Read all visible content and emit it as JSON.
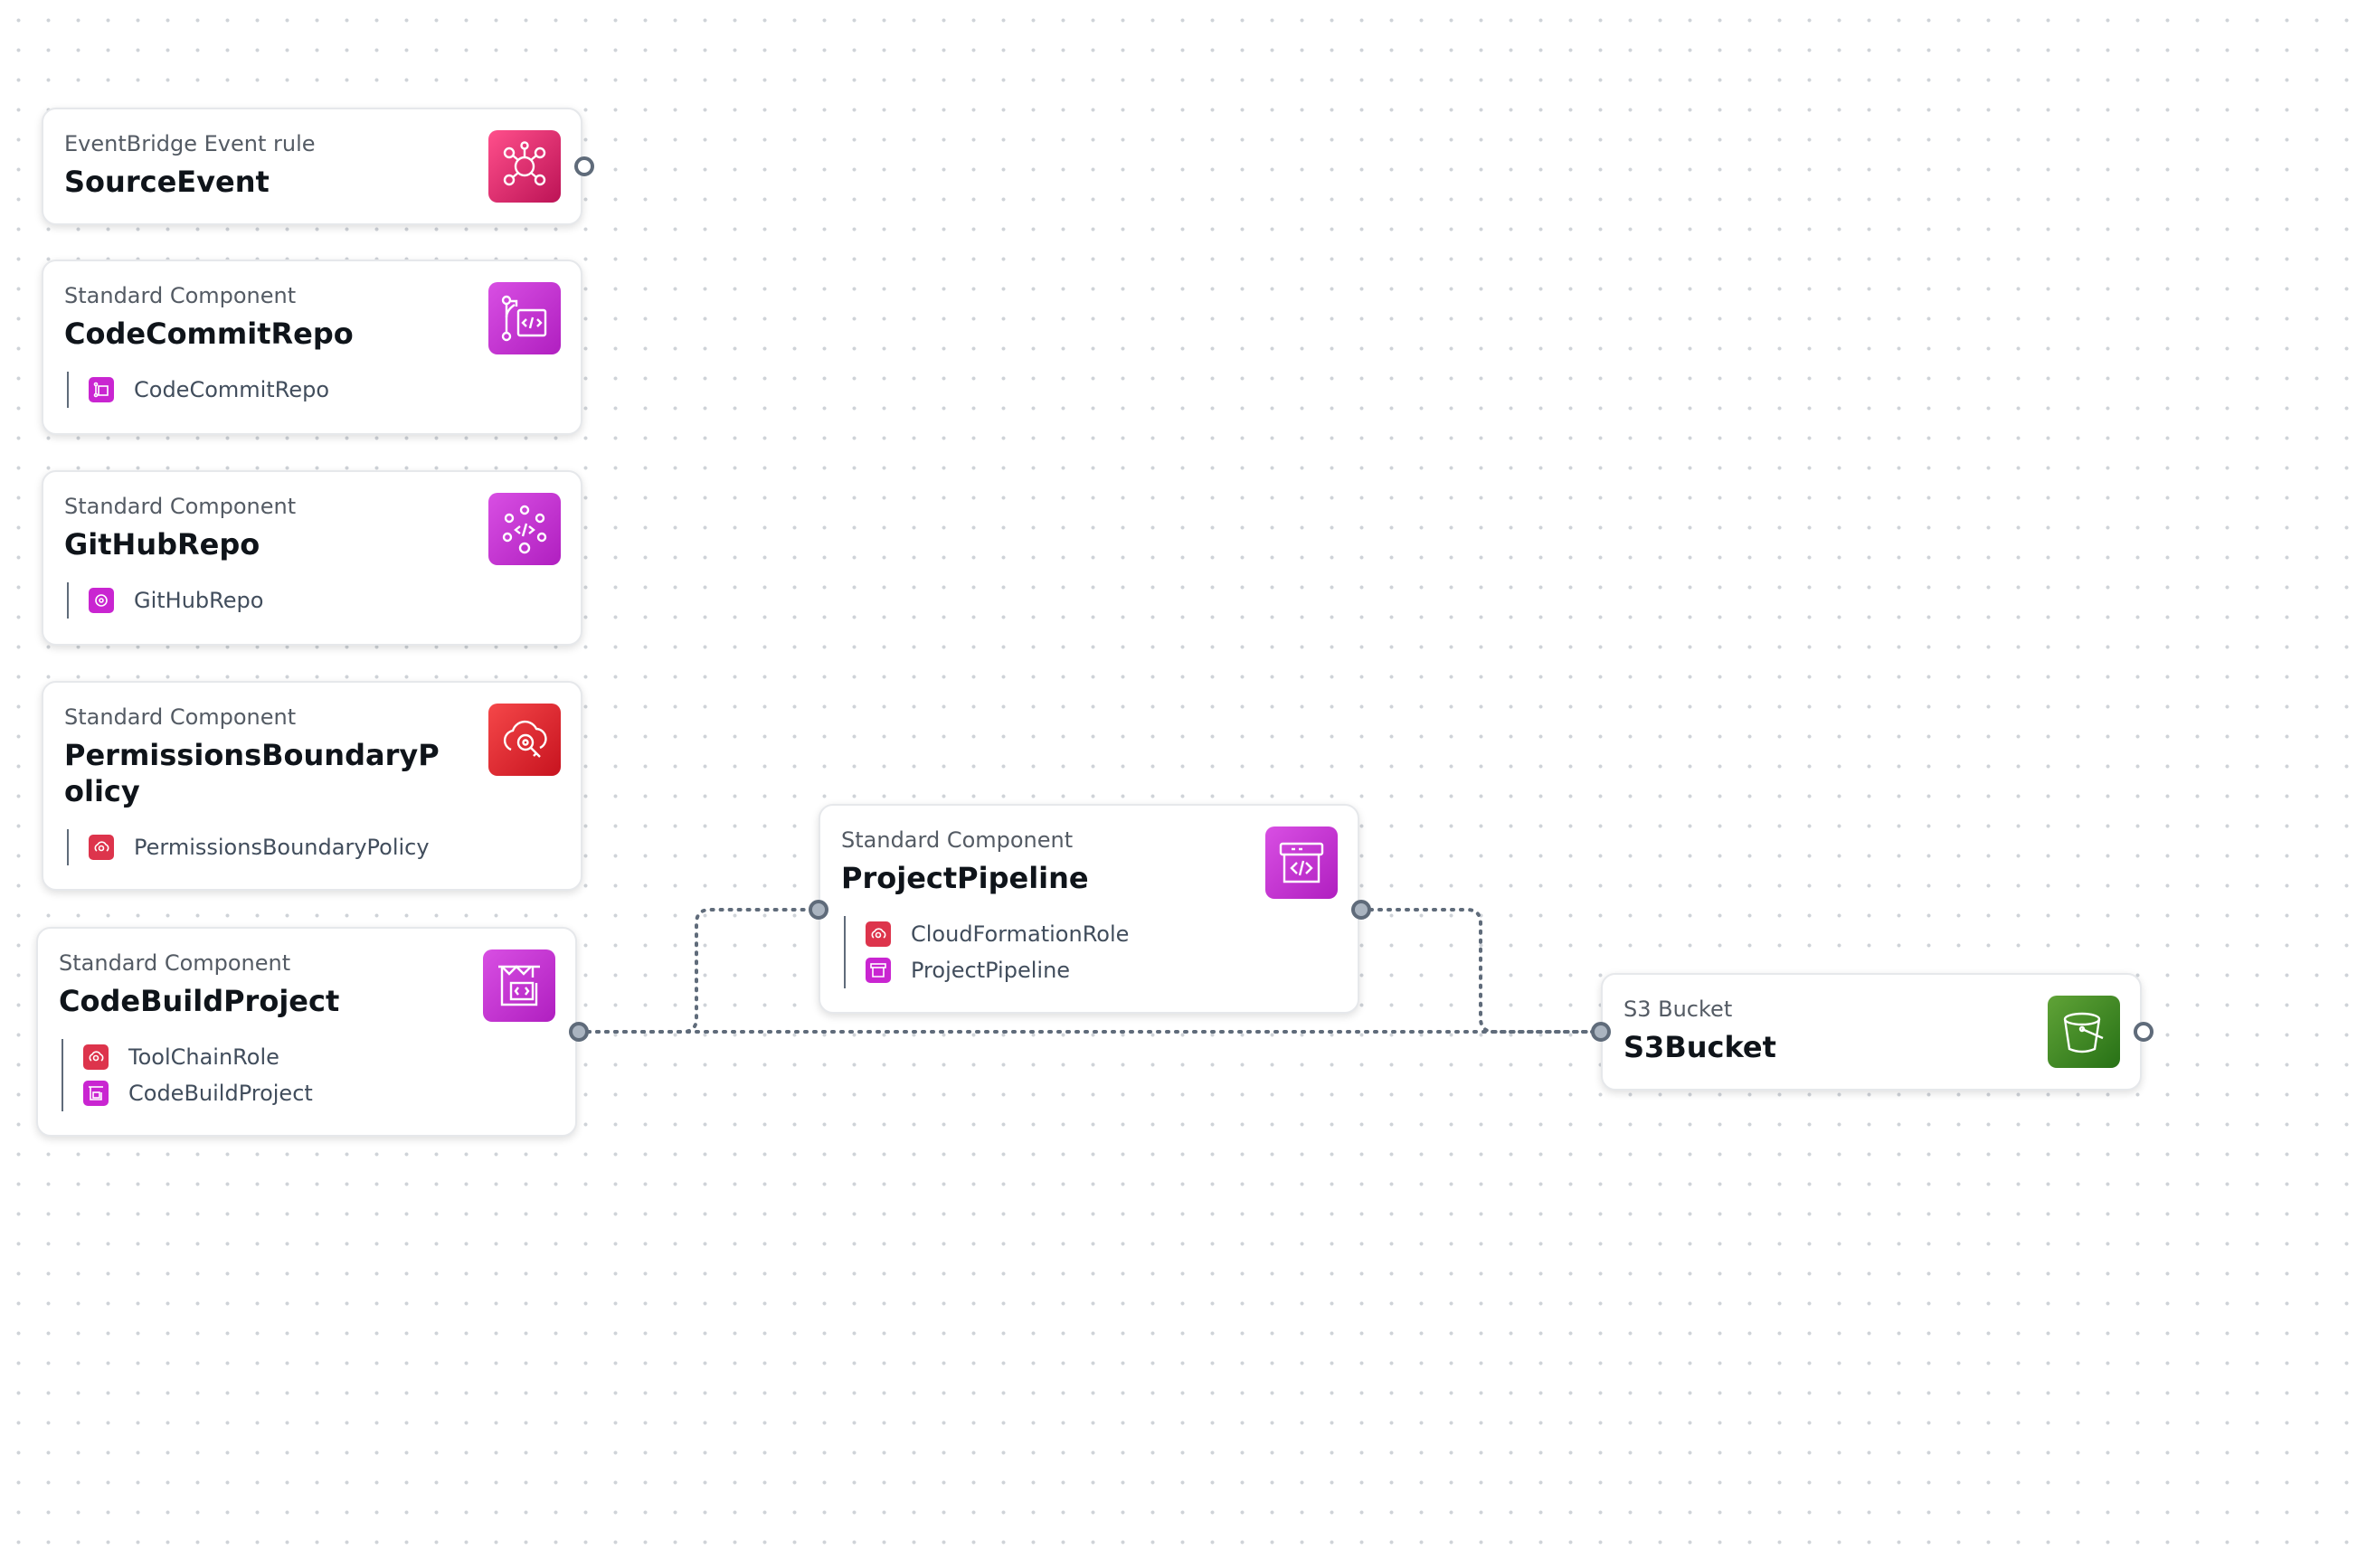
{
  "colors": {
    "canvas_background": "#ffffff",
    "grid_dot": "#cfd3d8",
    "edge": "#5f6b7a",
    "devtools_magenta": "#c925d1",
    "security_red": "#dd344c",
    "storage_green": "#3f8624",
    "eventbridge_pink": "#e7157b"
  },
  "nodes": {
    "source_event": {
      "type_label": "EventBridge Event rule",
      "name": "SourceEvent",
      "icon": "eventbridge-icon"
    },
    "codecommit_repo": {
      "type_label": "Standard Component",
      "name": "CodeCommitRepo",
      "icon": "codecommit-icon",
      "children": [
        {
          "label": "CodeCommitRepo",
          "icon": "codecommit-icon"
        }
      ]
    },
    "github_repo": {
      "type_label": "Standard Component",
      "name": "GitHubRepo",
      "icon": "github-repo-icon",
      "children": [
        {
          "label": "GitHubRepo",
          "icon": "github-repo-icon"
        }
      ]
    },
    "permissions_boundary": {
      "type_label": "Standard Component",
      "name": "PermissionsBoundaryPolicy",
      "icon": "iam-policy-icon",
      "children": [
        {
          "label": "PermissionsBoundaryPolicy",
          "icon": "iam-policy-icon"
        }
      ]
    },
    "codebuild_project": {
      "type_label": "Standard Component",
      "name": "CodeBuildProject",
      "icon": "codebuild-icon",
      "children": [
        {
          "label": "ToolChainRole",
          "icon": "iam-role-icon"
        },
        {
          "label": "CodeBuildProject",
          "icon": "codebuild-icon"
        }
      ]
    },
    "project_pipeline": {
      "type_label": "Standard Component",
      "name": "ProjectPipeline",
      "icon": "codepipeline-icon",
      "children": [
        {
          "label": "CloudFormationRole",
          "icon": "iam-role-icon"
        },
        {
          "label": "ProjectPipeline",
          "icon": "codepipeline-icon"
        }
      ]
    },
    "s3_bucket": {
      "type_label": "S3 Bucket",
      "name": "S3Bucket",
      "icon": "s3-bucket-icon"
    }
  }
}
